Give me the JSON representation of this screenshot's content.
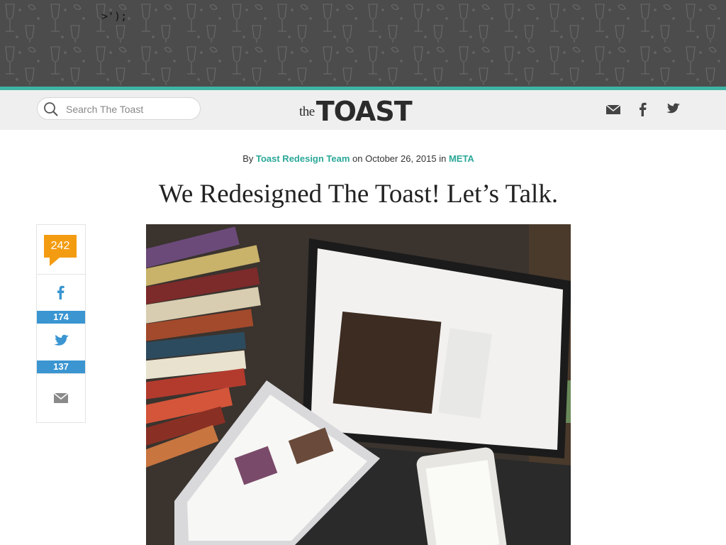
{
  "stray_text": ">');",
  "search": {
    "placeholder": "Search The Toast"
  },
  "logo": {
    "small": "the",
    "main": "TOAST"
  },
  "nav_icons": [
    "mail-icon",
    "facebook-icon",
    "twitter-icon"
  ],
  "article": {
    "byline_prefix": "By",
    "author": "Toast Redesign Team",
    "date_text": "on October 26, 2015 in",
    "category": "META",
    "title": "We Redesigned The Toast! Let’s Talk."
  },
  "share": {
    "comments": "242",
    "facebook_count": "174",
    "twitter_count": "137"
  },
  "colors": {
    "teal": "#3eb5a4",
    "comment_orange": "#f39c12",
    "count_blue": "#3a95d1",
    "header_pattern": "#4c4c4c"
  }
}
